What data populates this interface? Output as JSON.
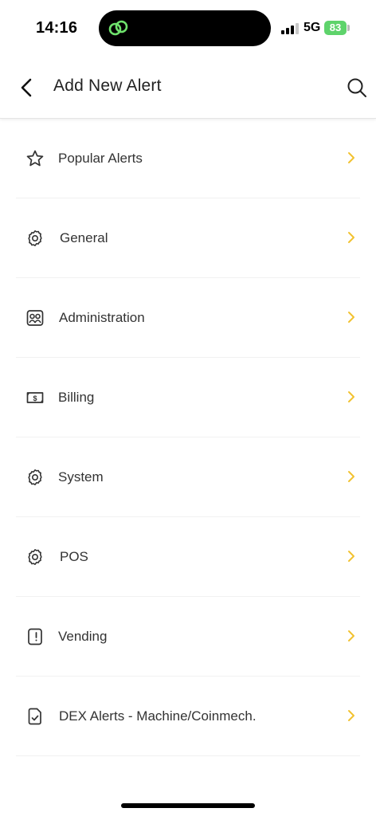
{
  "status_bar": {
    "time": "14:16",
    "network": "5G",
    "battery": "83"
  },
  "header": {
    "title": "Add New Alert",
    "back_icon": "chevron-left-icon",
    "search_icon": "search-icon"
  },
  "menu": {
    "items": [
      {
        "label": "Popular Alerts",
        "icon": "star-icon"
      },
      {
        "label": "General",
        "icon": "gear-icon"
      },
      {
        "label": "Administration",
        "icon": "admin-users-icon"
      },
      {
        "label": "Billing",
        "icon": "dollar-bill-icon"
      },
      {
        "label": "System",
        "icon": "gear-icon"
      },
      {
        "label": "POS",
        "icon": "gear-icon"
      },
      {
        "label": "Vending",
        "icon": "vending-machine-icon"
      },
      {
        "label": "DEX Alerts - Machine/Coinmech.",
        "icon": "document-check-icon"
      }
    ]
  },
  "colors": {
    "chevron": "#f2c230",
    "battery": "#5ed36b",
    "island_icon": "#6ee26c"
  }
}
